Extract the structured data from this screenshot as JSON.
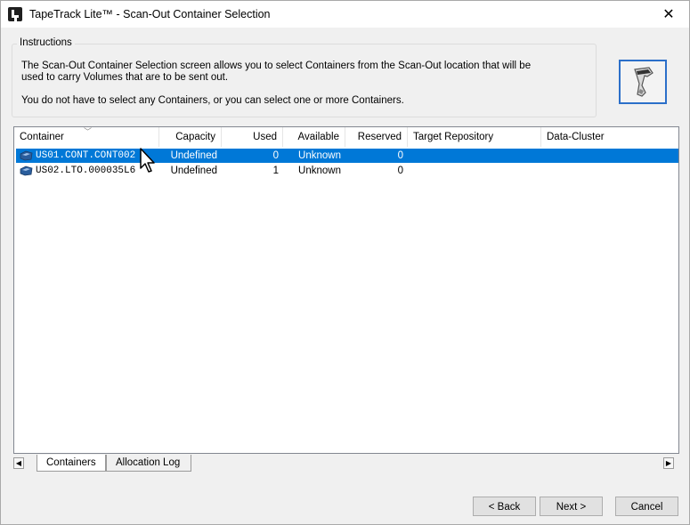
{
  "window": {
    "title": "TapeTrack Lite™ - Scan-Out Container Selection",
    "close_glyph": "✕"
  },
  "instructions": {
    "legend": "Instructions",
    "paragraph1": "The Scan-Out Container Selection screen allows you to select Containers from the Scan-Out location that will be used to carry Volumes that are to be sent out.",
    "paragraph2": "You do not have to select any Containers, or you can select one or more Containers.",
    "scanner_icon": "barcode-scanner-icon"
  },
  "table": {
    "columns": [
      "Container",
      "Capacity",
      "Used",
      "Available",
      "Reserved",
      "Target Repository",
      "Data-Cluster"
    ],
    "rows": [
      {
        "container": "US01.CONT.CONT002",
        "capacity": "Undefined",
        "used": "0",
        "available": "Unknown",
        "reserved": "0",
        "target_repository": "",
        "data_cluster": "",
        "selected": true
      },
      {
        "container": "US02.LTO.000035L6",
        "capacity": "Undefined",
        "used": "1",
        "available": "Unknown",
        "reserved": "0",
        "target_repository": "",
        "data_cluster": "",
        "selected": false
      }
    ]
  },
  "tabs": {
    "items": [
      "Containers",
      "Allocation Log"
    ],
    "active": "Containers"
  },
  "buttons": {
    "back": "< Back",
    "next": "Next >",
    "cancel": "Cancel"
  },
  "colors": {
    "selection": "#0078d7",
    "focus_border": "#2b6fc9"
  }
}
